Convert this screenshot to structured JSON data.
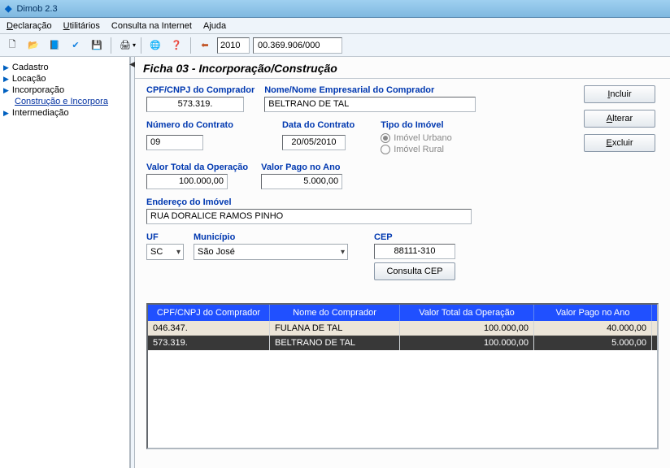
{
  "window": {
    "title": "Dimob 2.3"
  },
  "menu": {
    "declaracao": "Declaração",
    "utilitarios": "Utilitários",
    "consulta": "Consulta na Internet",
    "ajuda": "Ajuda"
  },
  "toolbar": {
    "year": "2010",
    "cnpj": "00.369.906/000"
  },
  "sidebar": {
    "items": [
      {
        "label": "Cadastro"
      },
      {
        "label": "Locação"
      },
      {
        "label": "Incorporação"
      },
      {
        "label": "Construção e Incorpora",
        "link": true,
        "indent": true
      },
      {
        "label": "Intermediação"
      }
    ]
  },
  "ficha": {
    "title": "Ficha 03 - Incorporação/Construção",
    "labels": {
      "cpf": "CPF/CNPJ do Comprador",
      "nome": "Nome/Nome Empresarial do Comprador",
      "numero": "Número do Contrato",
      "data": "Data do Contrato",
      "tipo": "Tipo do Imóvel",
      "urbano": "Imóvel Urbano",
      "rural": "Imóvel Rural",
      "total": "Valor Total da Operação",
      "pago": "Valor Pago no Ano",
      "endereco": "Endereço do Imóvel",
      "uf": "UF",
      "municipio": "Município",
      "cep": "CEP",
      "consulta_cep": "Consulta CEP"
    },
    "values": {
      "cpf": "573.319.",
      "nome": "BELTRANO DE TAL",
      "numero": "09",
      "data": "20/05/2010",
      "total": "100.000,00",
      "pago": "5.000,00",
      "endereco": "RUA DORALICE RAMOS PINHO",
      "uf": "SC",
      "municipio": "São José",
      "cep": "88111-310"
    },
    "buttons": {
      "incluir": "Incluir",
      "alterar": "Alterar",
      "excluir": "Excluir"
    }
  },
  "grid": {
    "headers": {
      "c1": "CPF/CNPJ do Comprador",
      "c2": "Nome do Comprador",
      "c3": "Valor Total da Operação",
      "c4": "Valor Pago no Ano"
    },
    "rows": [
      {
        "c1": "046.347.",
        "c2": "FULANA DE TAL",
        "c3": "100.000,00",
        "c4": "40.000,00"
      },
      {
        "c1": "573.319.",
        "c2": "BELTRANO DE TAL",
        "c3": "100.000,00",
        "c4": "5.000,00"
      }
    ]
  }
}
